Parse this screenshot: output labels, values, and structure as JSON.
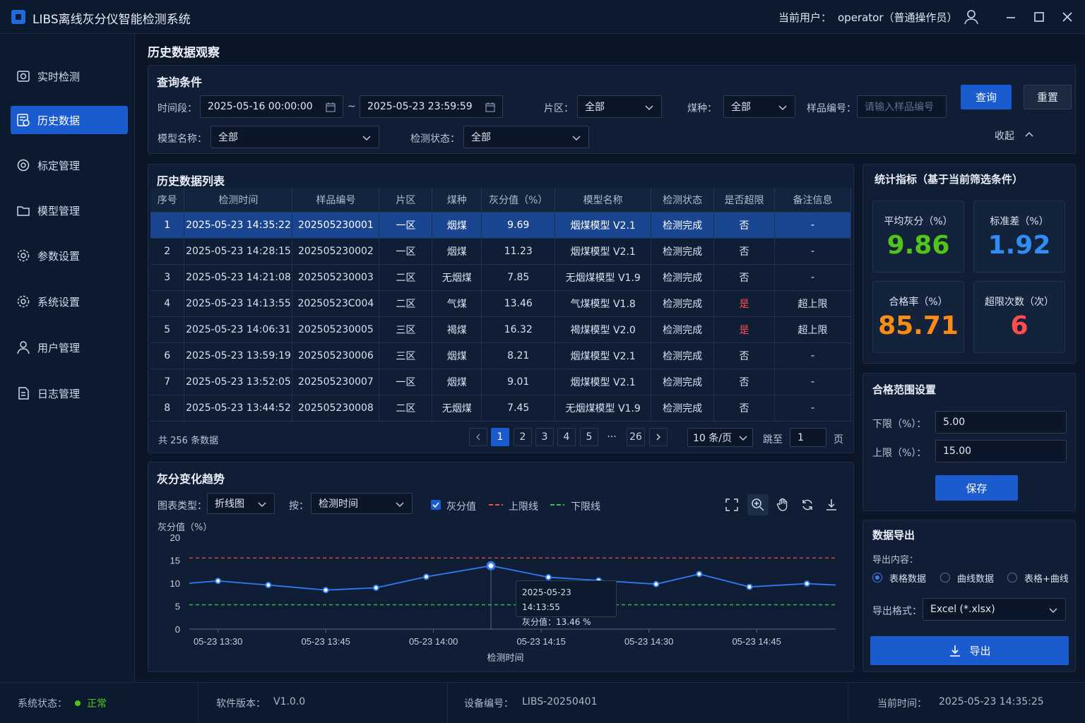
{
  "app": {
    "title": "LIBS离线灰分仪智能检测系统",
    "user_label": "当前用户：",
    "user_name": "operator（普通操作员）"
  },
  "sidebar": {
    "items": [
      {
        "label": "实时检测",
        "icon": "camera-icon"
      },
      {
        "label": "历史数据",
        "icon": "history-icon",
        "active": true
      },
      {
        "label": "标定管理",
        "icon": "target-icon"
      },
      {
        "label": "模型管理",
        "icon": "folder-icon"
      },
      {
        "label": "参数设置",
        "icon": "gear-icon"
      },
      {
        "label": "系统设置",
        "icon": "gear-icon"
      },
      {
        "label": "用户管理",
        "icon": "user-icon"
      },
      {
        "label": "日志管理",
        "icon": "log-icon"
      }
    ]
  },
  "page": {
    "title": "历史数据观察"
  },
  "query": {
    "title": "查询条件",
    "time_label": "时间段：",
    "start": "2025-05-16  00:00:00",
    "tilde": "~",
    "end": "2025-05-23  23:59:59",
    "zone_label": "片区：",
    "zone_value": "全部",
    "coal_label": "煤种：",
    "coal_value": "全部",
    "sample_label": "样品编号：",
    "sample_placeholder": "请输入样品编号",
    "model_label": "模型名称：",
    "model_value": "全部",
    "status_label": "检测状态：",
    "status_value": "全部",
    "query_btn": "查询",
    "reset_btn": "重置",
    "collapse": "收起"
  },
  "table": {
    "title": "历史数据列表",
    "columns": [
      "序号",
      "检测时间",
      "样品编号",
      "片区",
      "煤种",
      "灰分值（%）",
      "模型名称",
      "检测状态",
      "是否超限",
      "备注信息"
    ],
    "rows": [
      [
        "1",
        "2025-05-23 14:35:22",
        "202505230001",
        "一区",
        "烟煤",
        "9.69",
        "烟煤模型  V2.1",
        "检测完成",
        "否",
        "-"
      ],
      [
        "2",
        "2025-05-23 14:28:15",
        "202505230002",
        "一区",
        "烟煤",
        "11.23",
        "烟煤模型  V2.1",
        "检测完成",
        "否",
        "-"
      ],
      [
        "3",
        "2025-05-23 14:21:08",
        "202505230003",
        "二区",
        "无烟煤",
        "7.85",
        "无烟煤模型  V1.9",
        "检测完成",
        "否",
        "-"
      ],
      [
        "4",
        "2025-05-23 14:13:55",
        "20250523C004",
        "二区",
        "气煤",
        "13.46",
        "气煤模型  V1.8",
        "检测完成",
        "是",
        "超上限"
      ],
      [
        "5",
        "2025-05-23 14:06:31",
        "202505230005",
        "三区",
        "褐煤",
        "16.32",
        "褐煤模型  V2.0",
        "检测完成",
        "是",
        "超上限"
      ],
      [
        "6",
        "2025-05-23 13:59:19",
        "202505230006",
        "三区",
        "烟煤",
        "8.21",
        "烟煤模型  V2.1",
        "检测完成",
        "否",
        "-"
      ],
      [
        "7",
        "2025-05-23 13:52:05",
        "202505230007",
        "一区",
        "烟煤",
        "9.01",
        "烟煤模型  V2.1",
        "检测完成",
        "否",
        "-"
      ],
      [
        "8",
        "2025-05-23 13:44:52",
        "202505230008",
        "二区",
        "无烟煤",
        "7.45",
        "无烟煤模型  V1.9",
        "检测完成",
        "否",
        "-"
      ]
    ],
    "selected_row": 0,
    "total": "共 256 条数据",
    "pages": [
      "1",
      "2",
      "3",
      "4",
      "5",
      "···",
      "26"
    ],
    "current_page": "1",
    "page_size": "10 条/页",
    "jump_label": "跳至",
    "jump_value": "1",
    "page_unit": "页"
  },
  "trend": {
    "title": "灰分变化趋势",
    "type_label": "图表类型：",
    "type_value": "折线图",
    "by_label": "按：",
    "by_value": "检测时间",
    "legend_ash": "灰分值",
    "legend_upper": "上限线",
    "legend_lower": "下限线"
  },
  "chart_data": {
    "type": "line",
    "ylabel": "灰分值（%）",
    "xlabel": "检测时间",
    "ylim": [
      0,
      20
    ],
    "yticks": [
      "0",
      "5",
      "10",
      "15",
      "20"
    ],
    "xticks": [
      "05-23 13:30",
      "05-23 13:45",
      "05-23 14:00",
      "05-23 14:15",
      "05-23 14:30",
      "05-23 14:45"
    ],
    "x": [
      "13:26",
      "13:30",
      "13:37",
      "13:45",
      "13:52",
      "13:59",
      "14:08",
      "14:16",
      "14:23",
      "14:31",
      "14:37",
      "14:44",
      "14:52",
      "14:56"
    ],
    "series": [
      {
        "name": "灰分值",
        "values": [
          10.0,
          10.5,
          9.6,
          8.5,
          9.0,
          11.4,
          13.8,
          11.3,
          10.6,
          9.8,
          12.0,
          9.2,
          9.9,
          9.6
        ],
        "color": "#2f7bf5"
      }
    ],
    "upper_limit": 15.5,
    "lower_limit": 5.3,
    "tooltip": {
      "time": "2025-05-23 14:13:55",
      "value": "灰分值：13.46 %"
    },
    "grid": false
  },
  "stats": {
    "title": "统计指标（基于当前筛选条件）",
    "cards": [
      {
        "label": "平均灰分（%）",
        "value": "9.86",
        "color": "#52c41a"
      },
      {
        "label": "标准差（%）",
        "value": "1.92",
        "color": "#2f8df5"
      },
      {
        "label": "合格率（%）",
        "value": "85.71",
        "color": "#fa8c16"
      },
      {
        "label": "超限次数（次）",
        "value": "6",
        "color": "#ff4d4f"
      }
    ]
  },
  "range": {
    "title": "合格范围设置",
    "lower_label": "下限（%）：",
    "lower_value": "5.00",
    "upper_label": "上限（%）：",
    "upper_value": "15.00",
    "save": "保存"
  },
  "export": {
    "title": "数据导出",
    "content_label": "导出内容：",
    "options": [
      "表格数据",
      "曲线数据",
      "表格+曲线"
    ],
    "selected": 0,
    "format_label": "导出格式：",
    "format_value": "Excel (*.xlsx)",
    "btn": "导出"
  },
  "footer": {
    "status_label": "系统状态：",
    "status_value": "正常",
    "version_label": "软件版本：",
    "version_value": "V1.0.0",
    "device_label": "设备编号：",
    "device_value": "LIBS-20250401",
    "time_label": "当前时间：",
    "time_value": "2025-05-23  14:35:25"
  }
}
